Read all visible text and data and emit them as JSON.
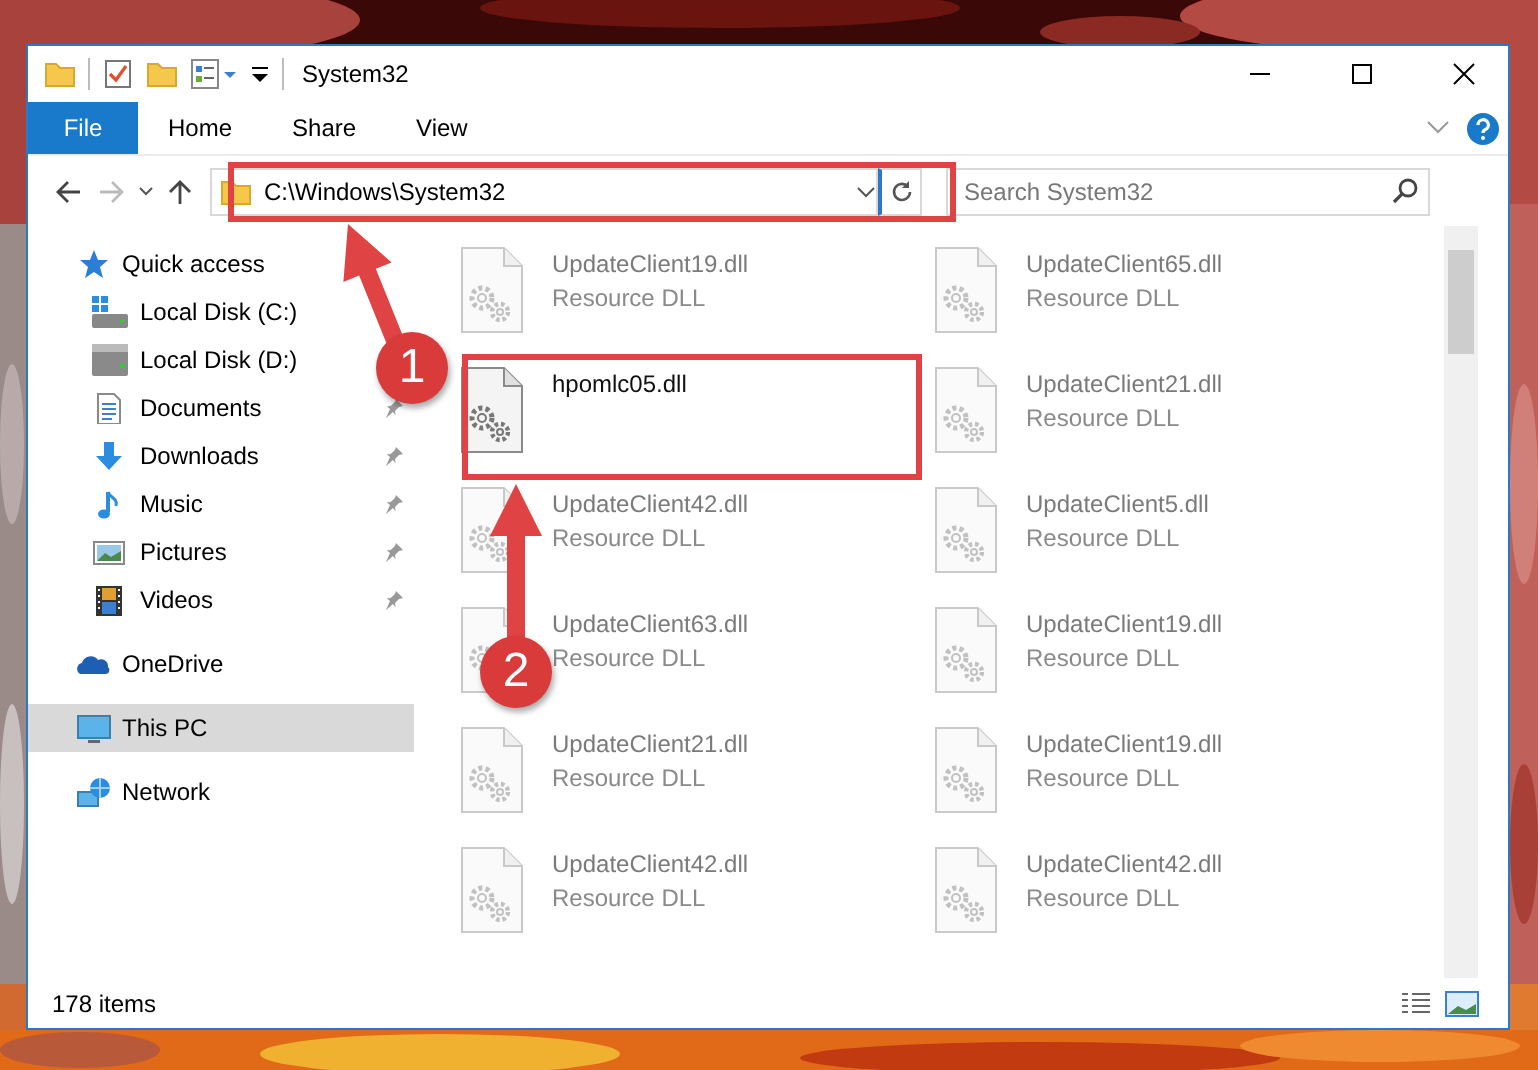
{
  "window": {
    "title": "System32"
  },
  "ribbon_tabs": [
    {
      "label": "File",
      "kind": "menu"
    },
    {
      "label": "Home",
      "kind": "tab"
    },
    {
      "label": "Share",
      "kind": "tab"
    },
    {
      "label": "View",
      "kind": "tab"
    }
  ],
  "address": {
    "path": "C:\\Windows\\System32"
  },
  "search": {
    "placeholder": "Search System32"
  },
  "sidebar": {
    "items": [
      {
        "label": "Quick access",
        "kind": "star",
        "selected": false,
        "children": [
          {
            "label": "Local Disk (C:)",
            "kind": "system-drive",
            "selected": false,
            "pinned": false
          },
          {
            "label": "Local Disk (D:)",
            "kind": "drive",
            "selected": false,
            "pinned": false
          },
          {
            "label": "Documents",
            "kind": "documents",
            "selected": false,
            "pinned": true
          },
          {
            "label": "Downloads",
            "kind": "downloads",
            "selected": false,
            "pinned": true
          },
          {
            "label": "Music",
            "kind": "music",
            "selected": false,
            "pinned": true
          },
          {
            "label": "Pictures",
            "kind": "pictures",
            "selected": false,
            "pinned": true
          },
          {
            "label": "Videos",
            "kind": "videos",
            "selected": false,
            "pinned": true
          }
        ]
      },
      {
        "label": "OneDrive",
        "kind": "cloud",
        "selected": false
      },
      {
        "label": "This PC",
        "kind": "computer",
        "selected": true
      },
      {
        "label": "Network",
        "kind": "network",
        "selected": false
      }
    ]
  },
  "files": [
    {
      "name": "UpdateClient19.dll",
      "type": "Resource DLL",
      "blurred": true
    },
    {
      "name": "UpdateClient65.dll",
      "type": "Resource DLL",
      "blurred": true
    },
    {
      "name": "hpomlc05.dll",
      "blurred": false
    },
    {
      "name": "UpdateClient21.dll",
      "type": "Resource DLL",
      "blurred": true
    },
    {
      "name": "UpdateClient42.dll",
      "type": "Resource DLL",
      "blurred": true
    },
    {
      "name": "UpdateClient5.dll",
      "type": "Resource DLL",
      "blurred": true
    },
    {
      "name": "UpdateClient63.dll",
      "type": "Resource DLL",
      "blurred": true
    },
    {
      "name": "UpdateClient19.dll",
      "type": "Resource DLL",
      "blurred": true
    },
    {
      "name": "UpdateClient21.dll",
      "type": "Resource DLL",
      "blurred": true
    },
    {
      "name": "UpdateClient19.dll",
      "type": "Resource DLL",
      "blurred": true
    },
    {
      "name": "UpdateClient42.dll",
      "type": "Resource DLL",
      "blurred": true
    },
    {
      "name": "UpdateClient42.dll",
      "type": "Resource DLL",
      "blurred": true
    }
  ],
  "status_bar": {
    "item_count": "178 items"
  },
  "annotations": [
    {
      "number": "1"
    },
    {
      "number": "2"
    }
  ]
}
